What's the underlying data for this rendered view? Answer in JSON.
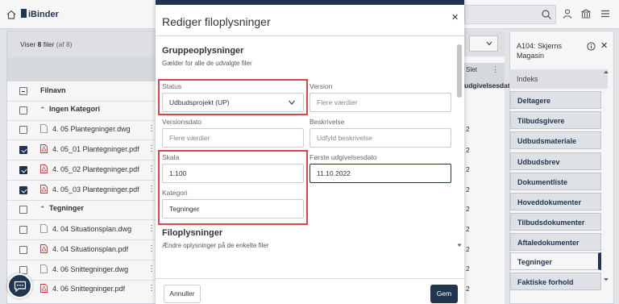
{
  "app": {
    "logo": "iBinder"
  },
  "colors": {
    "brand": "#1f3550",
    "highlight": "#d8464c",
    "pdf": "#d03838"
  },
  "file_panel": {
    "count_prefix": "Viser",
    "count_value": "8",
    "count_suffix": "filer",
    "count_total": "(af 8)",
    "column_filename": "Filnavn",
    "groups": [
      {
        "name": "Ingen Kategori",
        "files": [
          {
            "name": "4. 05 Plantegninger.dwg",
            "type": "dwg",
            "checked": false
          },
          {
            "name": "4. 05_01 Plantegninger.pdf",
            "type": "pdf",
            "checked": true
          },
          {
            "name": "4. 05_02 Plantegninger.pdf",
            "type": "pdf",
            "checked": true
          },
          {
            "name": "4. 05_03 Plantegninger.pdf",
            "type": "pdf",
            "checked": true
          }
        ]
      },
      {
        "name": "Tegninger",
        "files": [
          {
            "name": "4. 04 Situationsplan.dwg",
            "type": "dwg",
            "checked": false
          },
          {
            "name": "4. 04 Situationsplan.pdf",
            "type": "pdf",
            "checked": false
          },
          {
            "name": "4. 06 Snittegninger.dwg",
            "type": "dwg",
            "checked": false
          },
          {
            "name": "4. 06 Snittegninger.pdf",
            "type": "pdf",
            "checked": false
          }
        ]
      }
    ]
  },
  "middle": {
    "col_slet": "Slet",
    "col_udg": "udgivelsesdato",
    "values": [
      "2",
      "2",
      "2",
      "2",
      "2",
      "2",
      "2",
      "2",
      "2"
    ]
  },
  "modal": {
    "title": "Rediger filoplysninger",
    "group_section": {
      "title": "Gruppeoplysninger",
      "subtitle": "Gælder for alle de udvalgte filer"
    },
    "fields": {
      "status": {
        "label": "Status",
        "value": "Udbudsprojekt (UP)"
      },
      "version": {
        "label": "Version",
        "placeholder": "Flere værdier"
      },
      "versionsdato": {
        "label": "Versionsdato",
        "placeholder": "Flere værdier"
      },
      "beskrivelse": {
        "label": "Beskrivelse",
        "placeholder": "Udfyld beskrivelse"
      },
      "skala": {
        "label": "Skala",
        "value": "1:100"
      },
      "forste_udgivelsesdato": {
        "label": "Første udgivelsesdato",
        "value": "11.10.2022"
      },
      "kategori": {
        "label": "Kategori",
        "value": "Tegninger"
      }
    },
    "file_section": {
      "title": "Filoplysninger",
      "subtitle": "Ændre oplysninger på de enkelte filer"
    },
    "cancel_label": "Annuller",
    "save_label": "Gem"
  },
  "side_panel": {
    "title": "A104: Skjerns Magasin",
    "index_header": "Indeks",
    "items": [
      {
        "label": "Deltagere",
        "active": false
      },
      {
        "label": "Tilbudsgivere",
        "active": false
      },
      {
        "label": "Udbudsmateriale",
        "active": false
      },
      {
        "label": "Udbudsbrev",
        "active": false
      },
      {
        "label": "Dokumentliste",
        "active": false
      },
      {
        "label": "Hoveddokumenter",
        "active": false
      },
      {
        "label": "Tilbudsdokumenter",
        "active": false
      },
      {
        "label": "Aftaledokumenter",
        "active": false
      },
      {
        "label": "Tegninger",
        "active": true
      },
      {
        "label": "Faktiske forhold",
        "active": false
      }
    ]
  }
}
